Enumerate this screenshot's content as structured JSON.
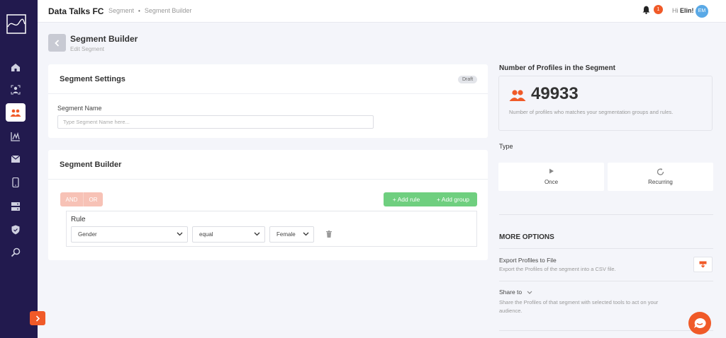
{
  "header": {
    "app_title": "Data Talks FC",
    "breadcrumb": [
      "Segment",
      "Segment Builder"
    ],
    "notification_count": "1",
    "greeting_prefix": "Hi ",
    "greeting_name": "Elin!",
    "avatar_initials": "EM"
  },
  "sidebar": {
    "items": [
      {
        "icon": "home-icon",
        "active": false
      },
      {
        "icon": "person-target-icon",
        "active": false
      },
      {
        "icon": "segment-users-icon",
        "active": true
      },
      {
        "icon": "analytics-icon",
        "active": false
      },
      {
        "icon": "mail-icon",
        "active": false
      },
      {
        "icon": "mobile-icon",
        "active": false
      },
      {
        "icon": "server-icon",
        "active": false
      },
      {
        "icon": "shield-icon",
        "active": false
      },
      {
        "icon": "search-icon",
        "active": false
      }
    ]
  },
  "page": {
    "title": "Segment Builder",
    "subtitle": "Edit Segment"
  },
  "settings": {
    "title": "Segment Settings",
    "status": "Draft",
    "name_label": "Segment Name",
    "name_placeholder": "Type Segment Name here...",
    "name_value": ""
  },
  "builder": {
    "title": "Segment Builder",
    "and_label": "AND",
    "or_label": "OR",
    "add_rule_label": "+ Add rule",
    "add_group_label": "+ Add group",
    "rule": {
      "label": "Rule",
      "field": "Gender",
      "operator": "equal",
      "value": "Female"
    }
  },
  "profiles": {
    "title": "Number of Profiles in the Segment",
    "count": "49933",
    "description": "Number of profiles who matches your segmentation groups and rules."
  },
  "type": {
    "label": "Type",
    "options": [
      "Once",
      "Recurring"
    ]
  },
  "more_options": {
    "title": "MORE OPTIONS",
    "export_title": "Export Profiles to File",
    "export_desc": "Export the Profiles of the segment into a CSV file.",
    "share_title": "Share to",
    "share_desc": "Share the Profiles of that segment with selected tools to act on your audience."
  },
  "colors": {
    "sidebar_bg": "#221a4e",
    "accent": "#f05a28",
    "add_button": "#6fcf7f",
    "logic_button": "#f7c2b6",
    "page_bg": "#f4f5fa"
  }
}
